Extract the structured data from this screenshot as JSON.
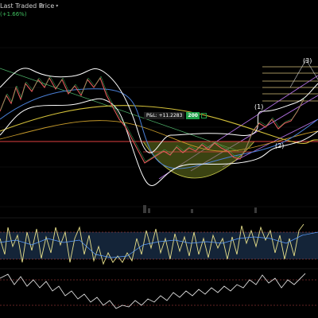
{
  "header": {
    "price_type": "Last Traded Price",
    "price_type_caret": "▾",
    "visibility_toggle": "⦾",
    "change": "(+1.66%)"
  },
  "position": {
    "pnl_text": "P&L: +11.2283",
    "qty": "200"
  },
  "waves": {
    "w1": "(1)",
    "w2": "(2)",
    "w3": "(3)"
  },
  "colors": {
    "background": "#000000",
    "bollinger": "#ffffff",
    "ema_yellow": "#d4c13a",
    "ema_blue": "#4a7fd6",
    "support_line": "#e0413f",
    "fib_lines": "#d7c27a",
    "rsi_band": "#1c3350",
    "positive": "#1fa04a"
  }
}
